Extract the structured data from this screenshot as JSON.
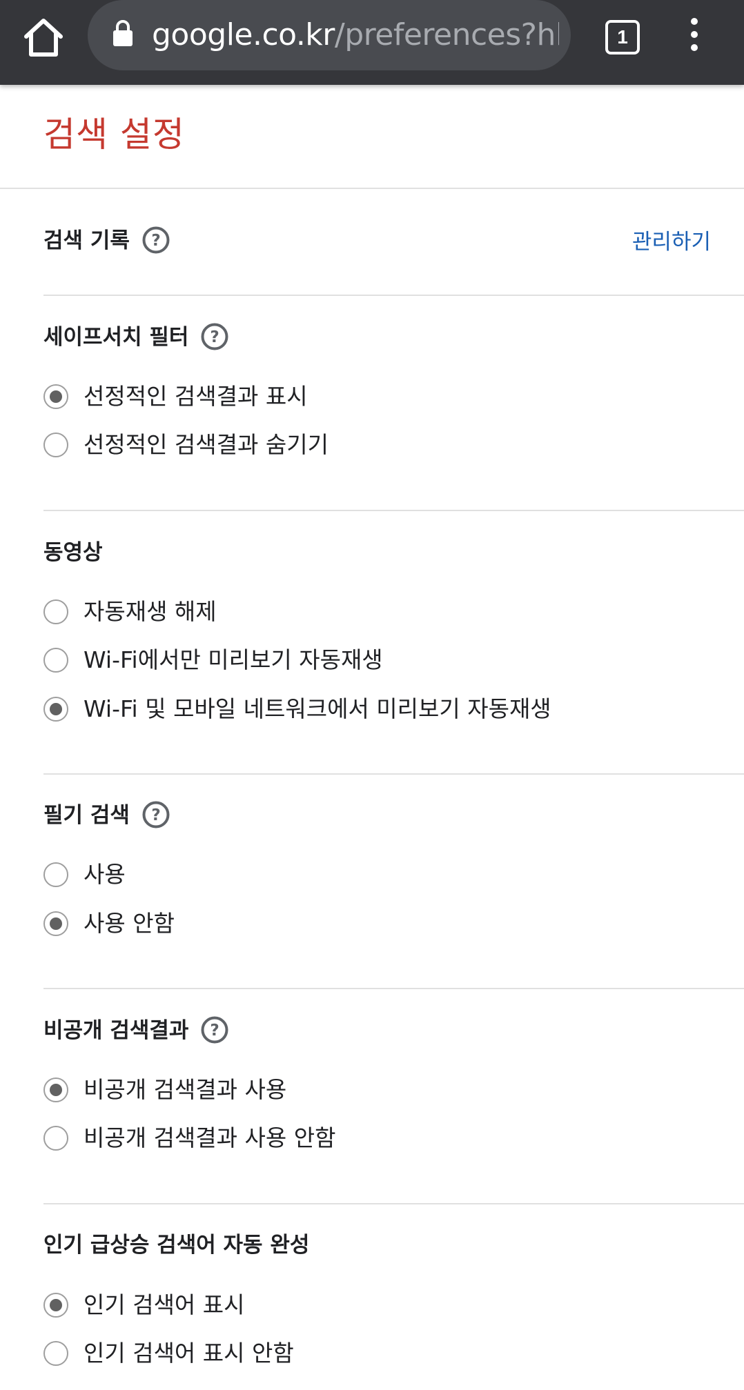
{
  "browser": {
    "url_host": "google.co.kr",
    "url_path": "/preferences?hl=",
    "tab_count": "1"
  },
  "page": {
    "title": "검색 설정"
  },
  "search_history": {
    "title": "검색 기록",
    "manage_label": "관리하기"
  },
  "safesearch": {
    "title": "세이프서치 필터",
    "options": [
      {
        "label": "선정적인 검색결과 표시",
        "checked": true
      },
      {
        "label": "선정적인 검색결과 숨기기",
        "checked": false
      }
    ]
  },
  "videos": {
    "title": "동영상",
    "options": [
      {
        "label": "자동재생 해제",
        "checked": false
      },
      {
        "label": "Wi-Fi에서만 미리보기 자동재생",
        "checked": false
      },
      {
        "label": "Wi-Fi 및 모바일 네트워크에서 미리보기 자동재생",
        "checked": true
      }
    ]
  },
  "handwrite": {
    "title": "필기 검색",
    "options": [
      {
        "label": "사용",
        "checked": false
      },
      {
        "label": "사용 안함",
        "checked": true
      }
    ]
  },
  "private_results": {
    "title": "비공개 검색결과",
    "options": [
      {
        "label": "비공개 검색결과 사용",
        "checked": true
      },
      {
        "label": "비공개 검색결과 사용 안함",
        "checked": false
      }
    ]
  },
  "trending": {
    "title": "인기 급상승 검색어 자동 완성",
    "options": [
      {
        "label": "인기 검색어 표시",
        "checked": true
      },
      {
        "label": "인기 검색어 표시 안함",
        "checked": false
      }
    ]
  },
  "colors": {
    "title_red": "#c5392f",
    "link_blue": "#1a5fb4",
    "toolbar": "#35363a"
  }
}
